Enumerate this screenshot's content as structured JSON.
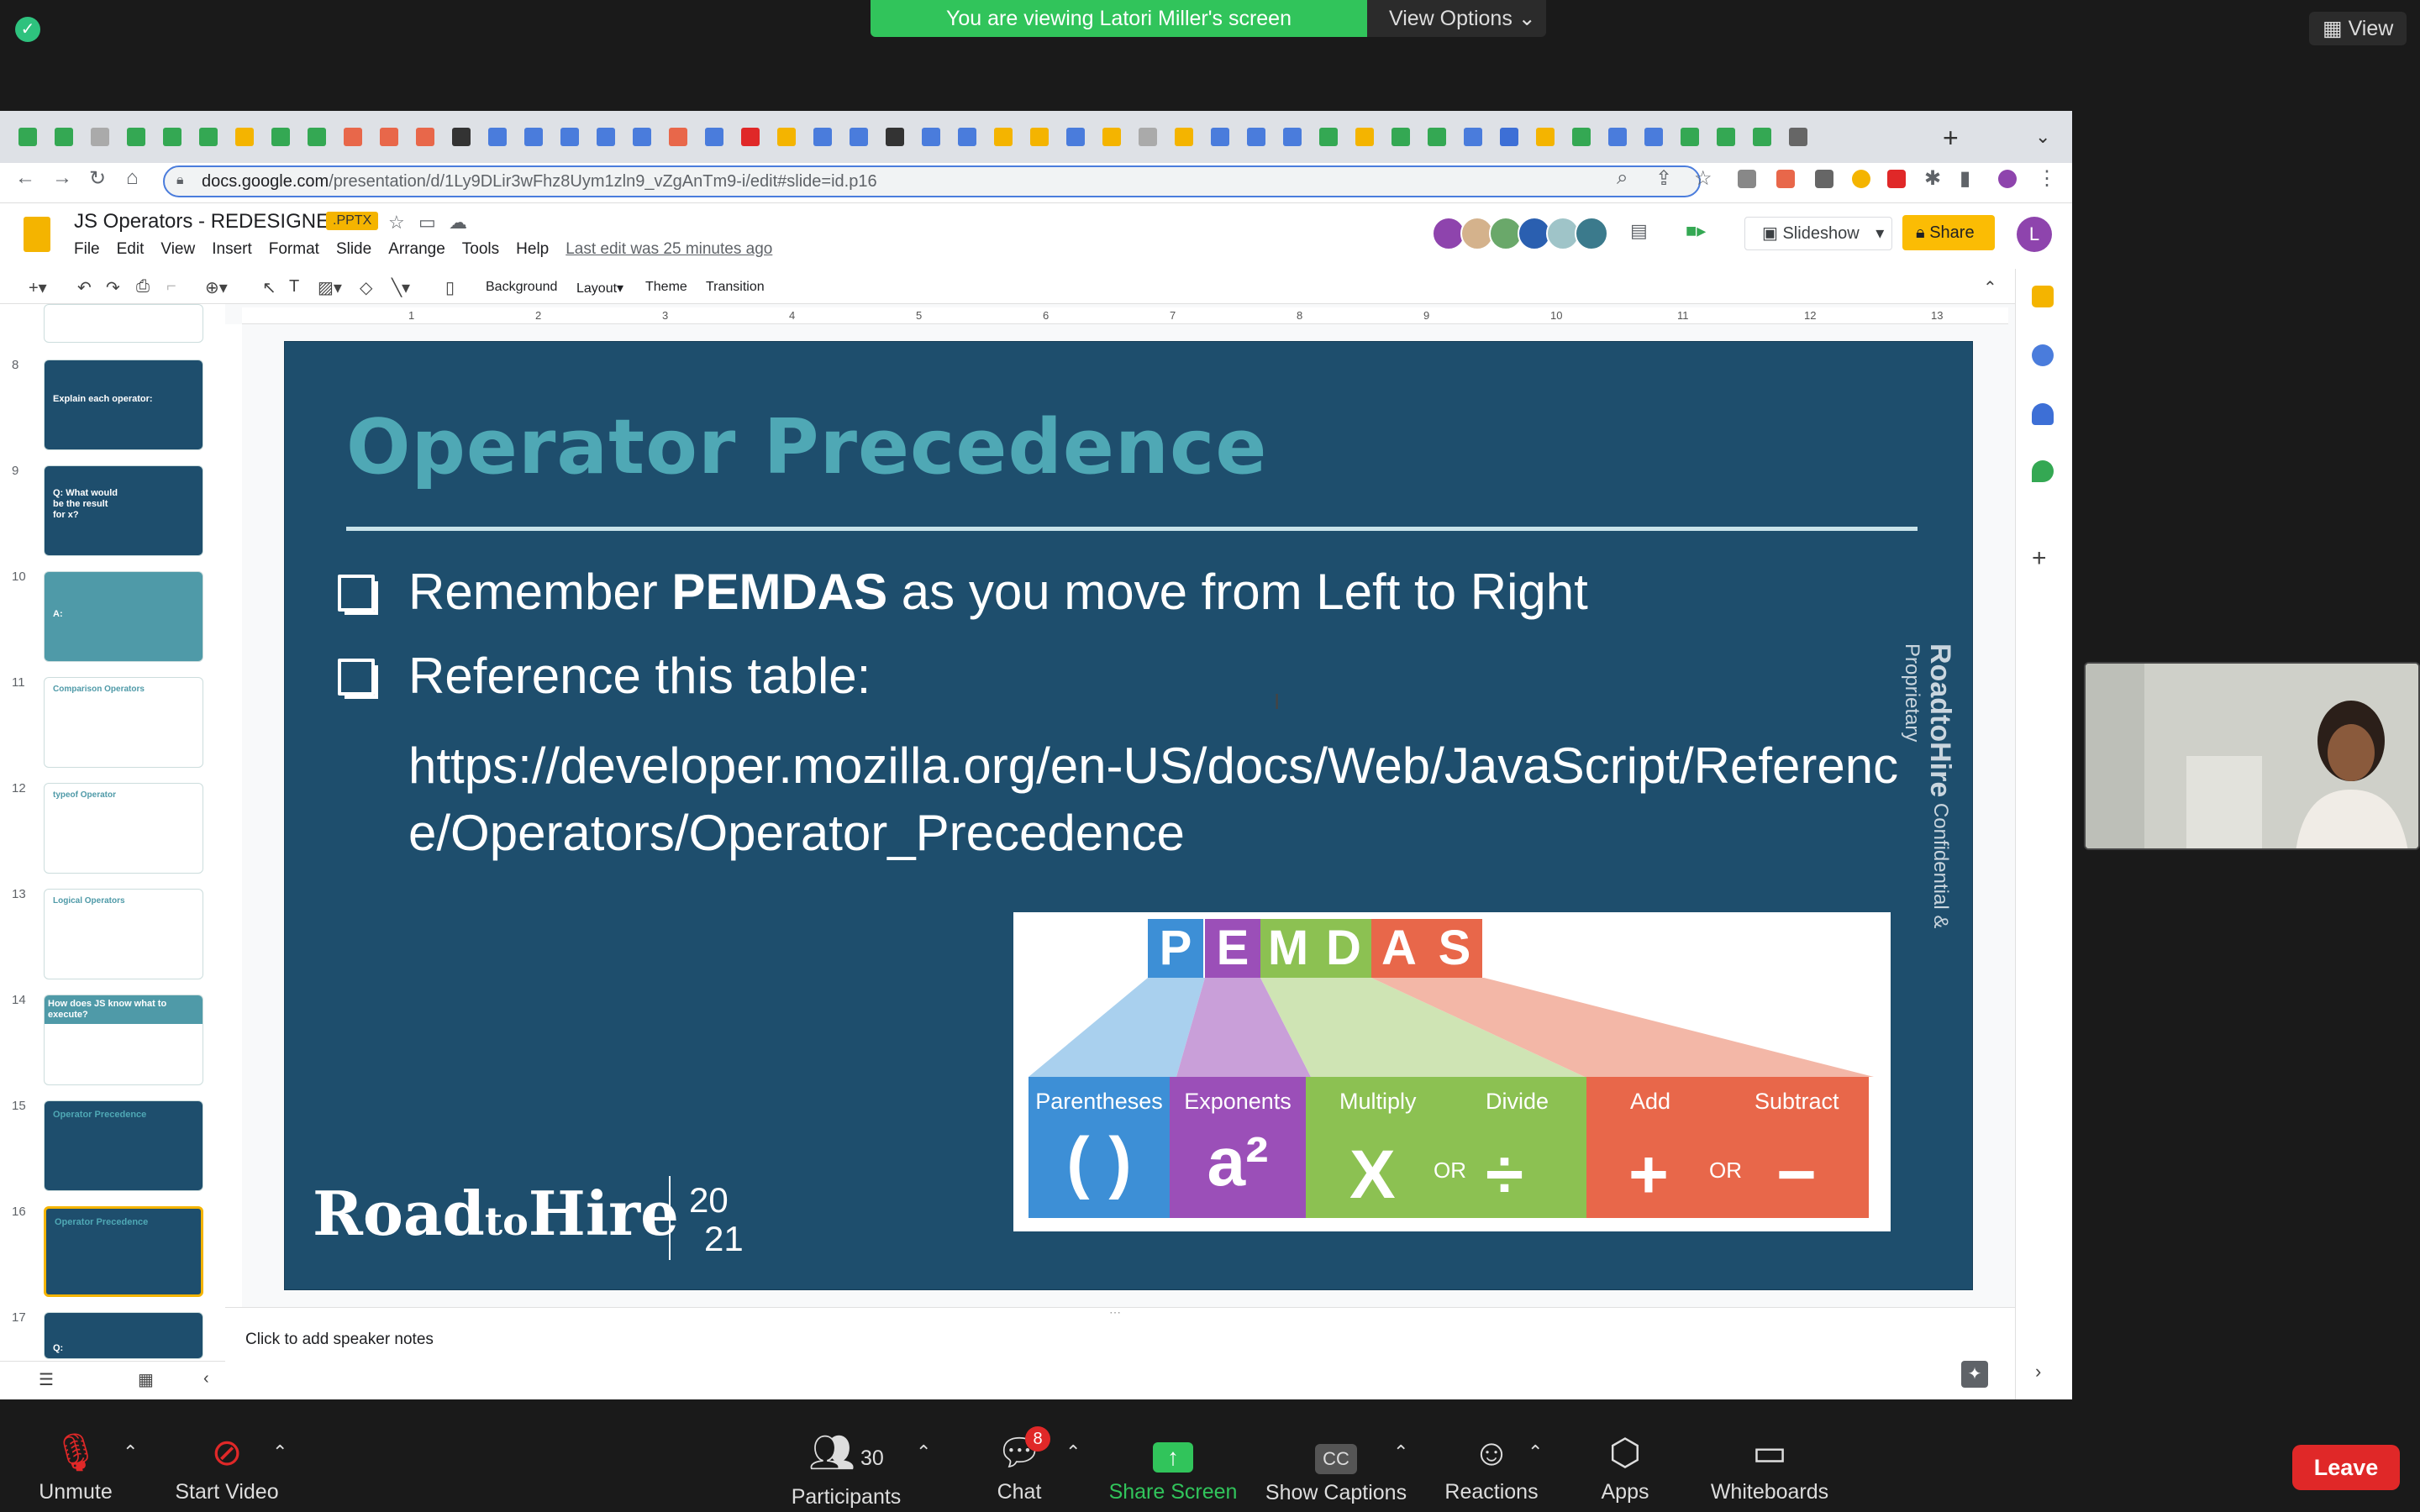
{
  "zoom": {
    "viewing_banner": "You are viewing Latori Miller's screen",
    "view_options": "View Options",
    "view_button": "View",
    "bottom": {
      "unmute": "Unmute",
      "start_video": "Start Video",
      "participants": "Participants",
      "participants_count": "30",
      "chat": "Chat",
      "chat_badge": "8",
      "share_screen": "Share Screen",
      "show_captions": "Show Captions",
      "reactions": "Reactions",
      "apps": "Apps",
      "whiteboards": "Whiteboards",
      "leave": "Leave"
    },
    "accent_green": "#31c45b",
    "leave_color": "#e02828"
  },
  "browser": {
    "url_host": "docs.google.com",
    "url_path": "/presentation/d/1Ly9DLir3wFhz8Uym1zln9_vZgAnTm9-i/edit#slide=id.p16"
  },
  "docs": {
    "title": "JS Operators - REDESIGNED",
    "badge": ".PPTX",
    "menus": [
      "File",
      "Edit",
      "View",
      "Insert",
      "Format",
      "Slide",
      "Arrange",
      "Tools",
      "Help"
    ],
    "last_edit": "Last edit was 25 minutes ago",
    "slideshow": "Slideshow",
    "share": "Share",
    "user_initial": "L",
    "toolbar": {
      "background": "Background",
      "layout": "Layout",
      "theme": "Theme",
      "transition": "Transition"
    },
    "speaker_notes": "Click to add speaker notes",
    "ruler": [
      "1",
      "2",
      "3",
      "4",
      "5",
      "6",
      "7",
      "8",
      "9",
      "10",
      "11",
      "12",
      "13"
    ]
  },
  "filmstrip": [
    {
      "num": "8",
      "title": "Explain each operator:"
    },
    {
      "num": "9",
      "title": "Q: What would be the result for x?"
    },
    {
      "num": "10",
      "title": "A:"
    },
    {
      "num": "11",
      "title": "Comparison Operators"
    },
    {
      "num": "12",
      "title": "typeof Operator"
    },
    {
      "num": "13",
      "title": "Logical Operators"
    },
    {
      "num": "14",
      "title": "How does JS know what to execute?"
    },
    {
      "num": "15",
      "title": "Operator Precedence"
    },
    {
      "num": "16",
      "title": "Operator Precedence"
    },
    {
      "num": "17",
      "title": "Q:"
    }
  ],
  "slide": {
    "title": "Operator Precedence",
    "bullet1_pre": "Remember ",
    "bullet1_bold": "PEMDAS",
    "bullet1_post": " as you move from Left to Right",
    "bullet2": "Reference this table:",
    "url": "https://developer.mozilla.org/en-US/docs/Web/JavaScript/Reference/Operators/Operator_Precedence",
    "brand_road": "Road",
    "brand_to": "to",
    "brand_hire": "Hire",
    "year_top": "20",
    "year_bottom": "21",
    "side_brand": "RoadtoHire",
    "side_text": "Confidential & Proprietary",
    "pemdas": {
      "letters": [
        "P",
        "E",
        "M",
        "D",
        "A",
        "S"
      ],
      "labels": [
        "Parentheses",
        "Exponents",
        "Multiply",
        "Divide",
        "Add",
        "Subtract"
      ],
      "symbols": [
        "( )",
        "a²",
        "X",
        "÷",
        "+",
        "−"
      ],
      "or": "OR",
      "colors": [
        "#3d8fd6",
        "#9b4fb8",
        "#8cc152",
        "#e8674a"
      ]
    }
  }
}
